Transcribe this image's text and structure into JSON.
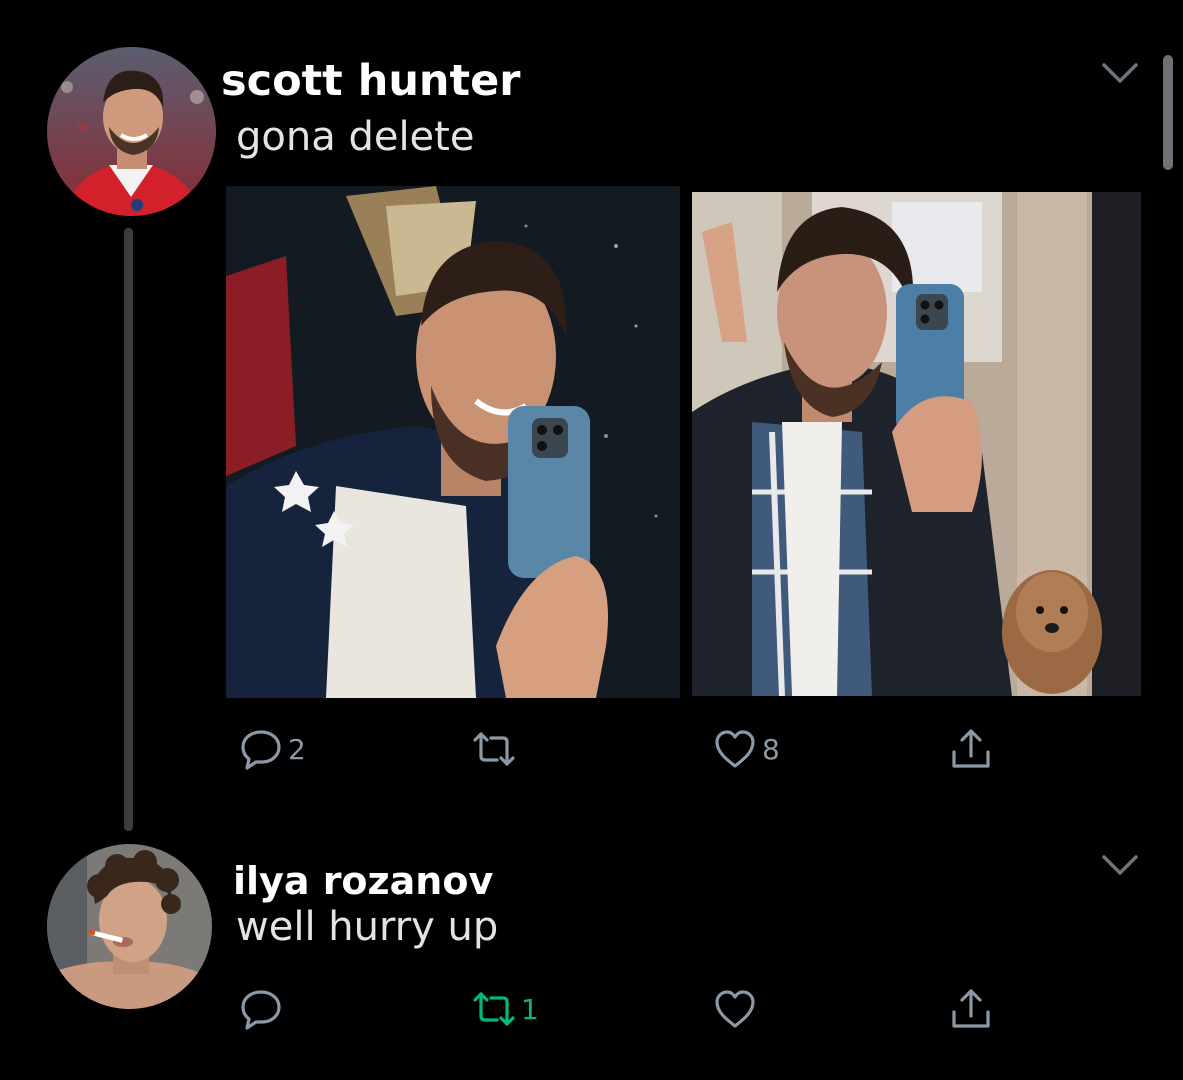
{
  "tweets": [
    {
      "display_name": "scott hunter",
      "text": "gona delete",
      "actions": {
        "reply_count": "2",
        "retweet_count": "",
        "like_count": "8"
      },
      "media": [
        {
          "icon": "photo-selfie-1"
        },
        {
          "icon": "photo-selfie-2"
        }
      ]
    },
    {
      "display_name": "ilya rozanov",
      "text": "well hurry up",
      "actions": {
        "reply_count": "",
        "retweet_count": "1",
        "like_count": ""
      }
    }
  ],
  "colors": {
    "background": "#000000",
    "icon_gray": "#8b98a5",
    "retweet_green": "#00ba7c",
    "thread_line": "#3a3d40"
  }
}
